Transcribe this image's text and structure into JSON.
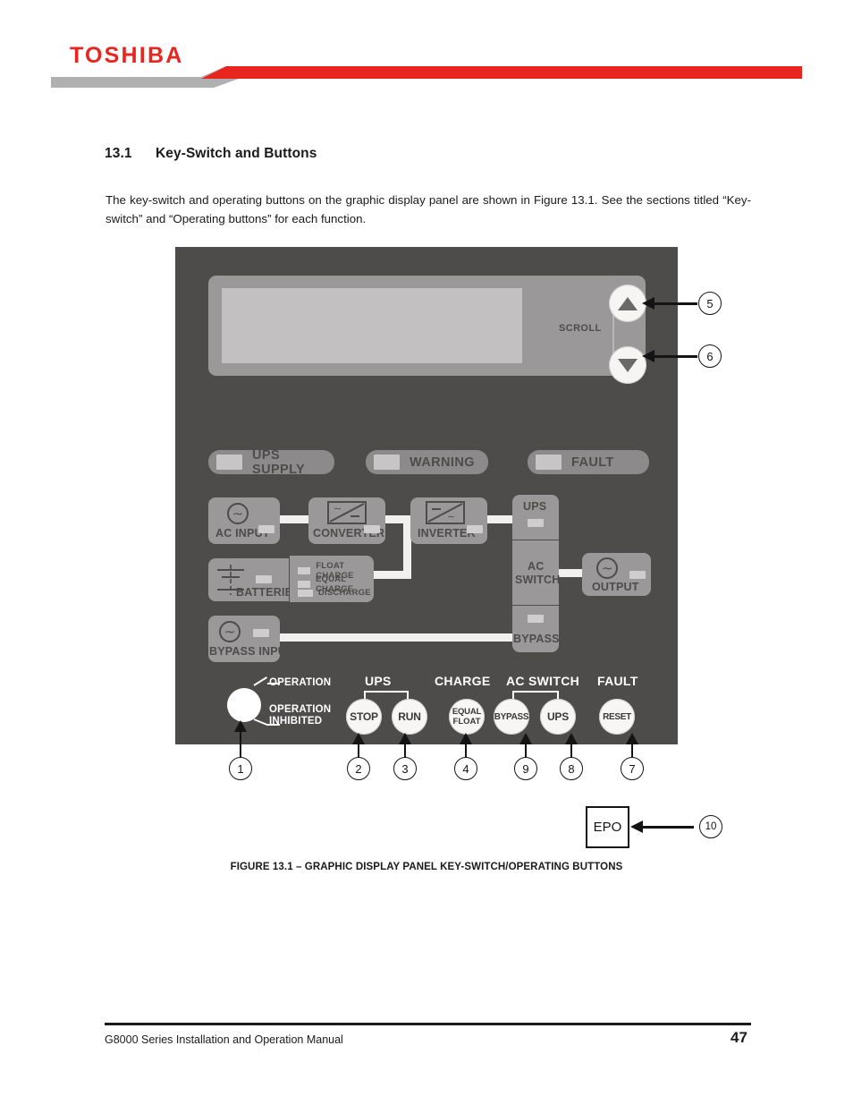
{
  "header": {
    "brand": "TOSHIBA",
    "brand_color": "#e8251f",
    "banner_gray": "#b0b0b0"
  },
  "section": {
    "number": "13.1",
    "title": "Key-Switch and Buttons",
    "intro": "The key-switch and operating buttons on the graphic display panel are shown in Figure 13.1. See the sections titled “Key-switch” and “Operating buttons” for each function."
  },
  "panel": {
    "background_color": "#4e4b4b",
    "lcd": {
      "bezel_color": "#9a9898",
      "screen_color": "#c2c0c0",
      "scroll_label": "SCROLL",
      "scroll_up_icon": "triangle-up-icon",
      "scroll_down_icon": "triangle-down-icon"
    },
    "status_indicators": [
      {
        "label": "UPS SUPPLY",
        "led": "led-indicator"
      },
      {
        "label": "WARNING",
        "led": "led-indicator"
      },
      {
        "label": "FAULT",
        "led": "led-indicator"
      }
    ],
    "mimic": {
      "ac_input": {
        "label": "AC INPUT",
        "icon": "ac-source-icon"
      },
      "converter": {
        "label": "CONVERTER",
        "icon": "converter-icon"
      },
      "inverter": {
        "label": "INVERTER",
        "icon": "inverter-icon"
      },
      "ups": {
        "label": "UPS"
      },
      "ac_switch": {
        "label_line1": "AC",
        "label_line2": "SWITCH"
      },
      "bypass_node": {
        "label": "BYPASS"
      },
      "batteries": {
        "label": "BATTERIES",
        "icon": "battery-cell-icon"
      },
      "charge_states": [
        {
          "label": "FLOAT CHARGE"
        },
        {
          "label": "EQUAL CHARGE"
        },
        {
          "label": "DISCHARGE"
        }
      ],
      "output": {
        "label": "OUTPUT",
        "icon": "ac-source-icon"
      },
      "bypass_input": {
        "label": "BYPASS INPUT",
        "icon": "ac-source-icon"
      }
    },
    "keyswitch": {
      "position_labels": [
        "OPERATION",
        "OPERATION INHIBITED"
      ],
      "label_top": "OPERATION",
      "label_bottom_line1": "OPERATION",
      "label_bottom_line2": "INHIBITED"
    },
    "button_groups": [
      {
        "title": "UPS",
        "buttons": [
          {
            "label": "STOP"
          },
          {
            "label": "RUN"
          }
        ]
      },
      {
        "title": "CHARGE",
        "buttons": [
          {
            "line1": "EQUAL",
            "line2": "FLOAT"
          }
        ]
      },
      {
        "title": "AC SWITCH",
        "buttons": [
          {
            "label": "BYPASS"
          },
          {
            "label": "UPS"
          }
        ]
      },
      {
        "title": "FAULT",
        "buttons": [
          {
            "label": "RESET"
          }
        ]
      }
    ]
  },
  "callouts": {
    "c1": "1",
    "c2": "2",
    "c3": "3",
    "c4": "4",
    "c5": "5",
    "c6": "6",
    "c7": "7",
    "c8": "8",
    "c9": "9",
    "c10": "10"
  },
  "epo": {
    "label": "EPO"
  },
  "figure": {
    "caption": "FIGURE 13.1 – GRAPHIC DISPLAY PANEL KEY-SWITCH/OPERATING BUTTONS"
  },
  "footer": {
    "text": "G8000 Series Installation and Operation Manual",
    "page": "47"
  }
}
